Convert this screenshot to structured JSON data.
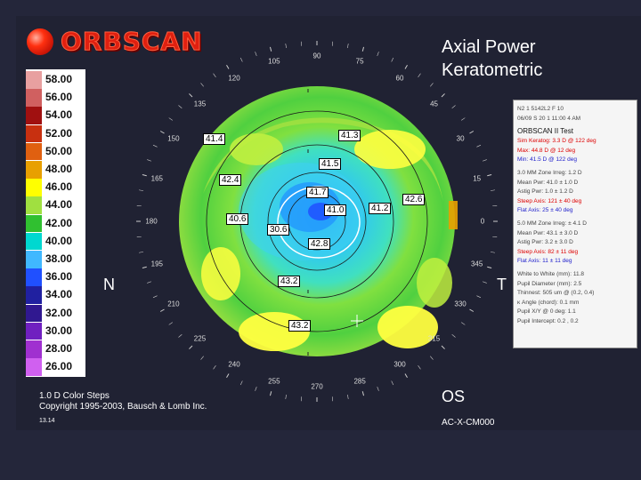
{
  "app": {
    "logo_text": "ORBSCAN",
    "title_line1": "Axial Power",
    "title_line2": "Keratometric"
  },
  "scale": {
    "values": [
      "58.00",
      "56.00",
      "54.00",
      "52.00",
      "50.00",
      "48.00",
      "46.00",
      "44.00",
      "42.00",
      "40.00",
      "38.00",
      "36.00",
      "34.00",
      "32.00",
      "30.00",
      "28.00",
      "26.00"
    ],
    "colors": [
      "#e8a0a0",
      "#d06060",
      "#a01010",
      "#c83010",
      "#e06010",
      "#e8a000",
      "#ffff00",
      "#a0e040",
      "#30c030",
      "#00d8d0",
      "#40b8ff",
      "#2050ff",
      "#2020a0",
      "#301890",
      "#7020c0",
      "#a030d0",
      "#d060f0"
    ]
  },
  "map": {
    "nasal_label": "N",
    "temporal_label": "T",
    "degree_labels": [
      "90",
      "75",
      "60",
      "45",
      "30",
      "15",
      "0",
      "345",
      "330",
      "315",
      "300",
      "285",
      "270",
      "255",
      "240",
      "225",
      "210",
      "195",
      "180",
      "165",
      "150",
      "135",
      "120",
      "105"
    ],
    "value_labels": [
      "41.4",
      "41.3",
      "41.5",
      "42.4",
      "41.7",
      "41.0",
      "41.2",
      "42.6",
      "40.6",
      "30.6",
      "42.8",
      "43.2",
      "43.2"
    ]
  },
  "panel": {
    "lines": [
      "N2 1 5142L2 F 10",
      "06/09 S 20 1 11:00 4 AM",
      "ORBSCAN II Test",
      "Sim Keratog: 3.3 D @ 122 deg",
      "Max: 44.8 D @ 12 deg",
      "Min: 41.5 D @ 122 deg",
      "3.0 MM Zone Irreg: 1.2 D",
      "Mean Pwr: 41.0 ± 1.0 D",
      "Astig Pwr: 1.0 ± 1.2 D",
      "Steep Axis: 121 ± 40 deg",
      "Flat Axis: 25 ± 40 deg",
      "5.0 MM Zone Irreg: ± 4.1 D",
      "Mean Pwr: 43.1 ± 3.0 D",
      "Astig Pwr: 3.2 ± 3.0 D",
      "Steep Axis: 82 ± 11 deg",
      "Flat Axis: 11 ± 11 deg",
      "White to White (mm): 11.8",
      "Pupil Diameter (mm): 2.5",
      "Thinnest: 505 um @ (0.2, 0.4)",
      "κ Angle (chord): 0.1 mm",
      "Pupil X/Y @ 0 deg: 1.1",
      "Pupil Intercept: 0.2 , 0.2"
    ]
  },
  "footer": {
    "color_steps": "1.0 D Color Steps",
    "copyright": "Copyright 1995-2003, Bausch & Lomb Inc.",
    "code": "13.14",
    "eye": "OS",
    "device": "AC-X-CM000"
  }
}
